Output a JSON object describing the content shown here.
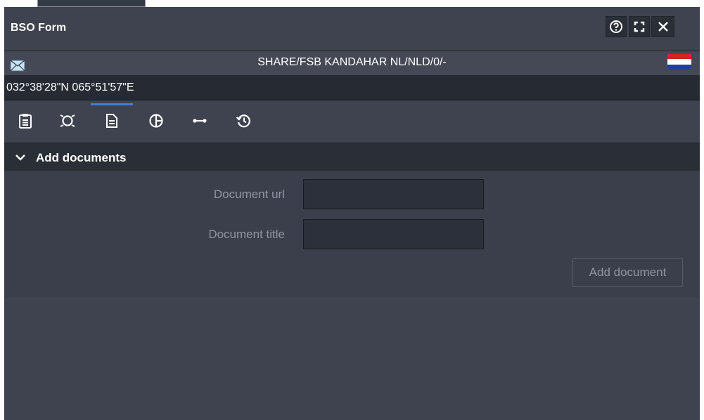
{
  "window": {
    "title": "BSO Form",
    "buttons": [
      {
        "name": "help",
        "icon": "help-circle-icon"
      },
      {
        "name": "fullscreen",
        "icon": "fullscreen-icon"
      },
      {
        "name": "close",
        "icon": "close-icon"
      }
    ]
  },
  "unit": {
    "name": "SHARE/FSB KANDAHAR NL/NLD/0/-",
    "message_icon": "envelope-icon",
    "flag_icon": "netherlands-flag-icon"
  },
  "location": {
    "coordinates": "032°38'28\"N 065°51'57\"E"
  },
  "tabs": [
    {
      "name": "details",
      "icon": "clipboard-icon",
      "active": false
    },
    {
      "name": "sensors",
      "icon": "target-icon",
      "active": false
    },
    {
      "name": "documents",
      "icon": "document-icon",
      "active": true
    },
    {
      "name": "affiliation",
      "icon": "half-circle-icon",
      "active": false
    },
    {
      "name": "relations",
      "icon": "link-icon",
      "active": false
    },
    {
      "name": "history",
      "icon": "history-icon",
      "active": false
    }
  ],
  "section": {
    "title": "Add documents",
    "expanded": true,
    "fields": {
      "url_label": "Document url",
      "url_value": "",
      "title_label": "Document title",
      "title_value": ""
    },
    "add_button_label": "Add document"
  },
  "colors": {
    "panel_bg": "#3f4350",
    "dark_bar": "#262a32",
    "active_tab_indicator": "#3d7fd6",
    "muted_text": "#8f95a2"
  }
}
